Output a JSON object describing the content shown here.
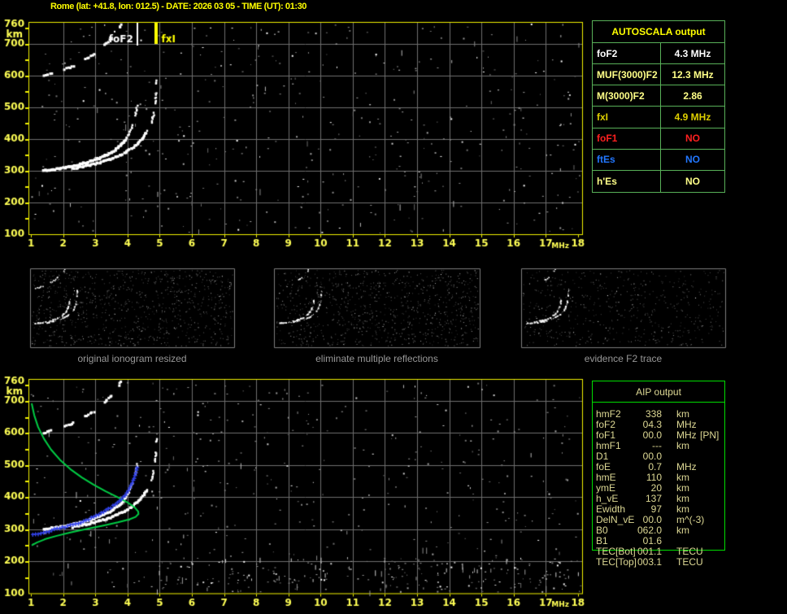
{
  "header": {
    "title": "Rome (lat: +41.8, lon: 012.5) - DATE: 2026 03 05 - TIME (UT): 01:30"
  },
  "colors": {
    "background": "#000000",
    "axis_border": "#f2f200",
    "tick_label": "#ffff55",
    "grid": "#6f6f6f",
    "trace_white": "#ffffff",
    "profile_green": "#00cc44",
    "restored_trace_blue": "#3344ee",
    "fof2_marker": "#ffffff",
    "fxi_marker": "#ffff00",
    "autoscala_border": "#58b058",
    "autoscala_title": "#ffff00",
    "aip_border": "#00dd00",
    "aip_text": "#ddd894",
    "caption_text": "#989898",
    "panel_border": "#7e7e7e"
  },
  "autoscala_table": {
    "title": "AUTOSCALA output",
    "rows": [
      {
        "label": "foF2",
        "value": "4.3 MHz",
        "color": "#ffffff"
      },
      {
        "label": "MUF(3000)F2",
        "value": "12.3 MHz",
        "color": "#ffff88"
      },
      {
        "label": "M(3000)F2",
        "value": "2.86",
        "color": "#ffff88"
      },
      {
        "label": "fxI",
        "value": "4.9 MHz",
        "color": "#dfd000"
      },
      {
        "label": "foF1",
        "value": "NO",
        "color": "#ff2020"
      },
      {
        "label": "ftEs",
        "value": "NO",
        "color": "#2277ff"
      },
      {
        "label": "h'Es",
        "value": "NO",
        "color": "#ffff88"
      }
    ]
  },
  "aip_table": {
    "title": "AIP output",
    "rows": [
      {
        "label": "hmF2",
        "value": "338",
        "unit": "km",
        "extra": ""
      },
      {
        "label": "foF2",
        "value": "04.3",
        "unit": "MHz",
        "extra": ""
      },
      {
        "label": "foF1",
        "value": "00.0",
        "unit": "MHz",
        "extra": "[PN]"
      },
      {
        "label": "hmF1",
        "value": "---",
        "unit": "km",
        "extra": ""
      },
      {
        "label": "D1",
        "value": "00.0",
        "unit": "",
        "extra": ""
      },
      {
        "label": "foE",
        "value": "0.7",
        "unit": "MHz",
        "extra": ""
      },
      {
        "label": "hmE",
        "value": "110",
        "unit": "km",
        "extra": ""
      },
      {
        "label": "ymE",
        "value": "20",
        "unit": "km",
        "extra": ""
      },
      {
        "label": "h_vE",
        "value": "137",
        "unit": "km",
        "extra": ""
      },
      {
        "label": "Ewidth",
        "value": "97",
        "unit": "km",
        "extra": ""
      },
      {
        "label": "DelN_vE",
        "value": "00.0",
        "unit": "m^(-3)",
        "extra": ""
      },
      {
        "label": "B0",
        "value": "062.0",
        "unit": "km",
        "extra": ""
      },
      {
        "label": "B1",
        "value": "01.6",
        "unit": "",
        "extra": ""
      },
      {
        "label": "TEC[Bot]",
        "value": "001.1",
        "unit": "TECU",
        "extra": ""
      },
      {
        "label": "TEC[Top]",
        "value": "003.1",
        "unit": "TECU",
        "extra": ""
      }
    ]
  },
  "panels": [
    {
      "caption": "original ionogram resized"
    },
    {
      "caption": "eliminate multiple reflections"
    },
    {
      "caption": "evidence F2 trace"
    }
  ],
  "chart_data": {
    "type": "scatter",
    "title": "Ionogram: virtual height (km) vs sounding frequency (MHz)",
    "x_axis": {
      "label": "MHz",
      "ticks": [
        1,
        2,
        3,
        4,
        5,
        6,
        7,
        8,
        9,
        10,
        11,
        12,
        13,
        14,
        15,
        16,
        17,
        18
      ],
      "range": [
        0.92,
        18.13
      ]
    },
    "y_axis": {
      "label": "km",
      "ticks": [
        760,
        700,
        600,
        500,
        400,
        300,
        200,
        100
      ],
      "range": [
        100,
        768
      ]
    },
    "grid": true,
    "annotations": [
      {
        "name": "foF2",
        "frequency_mhz": 4.3,
        "color": "#ffffff"
      },
      {
        "name": "fxI",
        "frequency_mhz": 4.9,
        "color": "#ffff00"
      }
    ],
    "traces": {
      "f2_ordinary": [
        [
          1.4,
          300
        ],
        [
          1.6,
          302
        ],
        [
          1.8,
          305
        ],
        [
          2.0,
          308
        ],
        [
          2.2,
          312
        ],
        [
          2.4,
          317
        ],
        [
          2.6,
          322
        ],
        [
          2.8,
          328
        ],
        [
          3.0,
          334
        ],
        [
          3.2,
          342
        ],
        [
          3.4,
          352
        ],
        [
          3.6,
          364
        ],
        [
          3.75,
          376
        ],
        [
          3.9,
          392
        ],
        [
          4.0,
          408
        ],
        [
          4.1,
          428
        ],
        [
          4.18,
          450
        ],
        [
          4.24,
          472
        ],
        [
          4.28,
          492
        ],
        [
          4.3,
          505
        ]
      ],
      "f2_extraordinary": [
        [
          2.3,
          306
        ],
        [
          2.6,
          312
        ],
        [
          2.9,
          319
        ],
        [
          3.2,
          327
        ],
        [
          3.5,
          337
        ],
        [
          3.8,
          350
        ],
        [
          4.05,
          364
        ],
        [
          4.25,
          379
        ],
        [
          4.45,
          398
        ],
        [
          4.6,
          420
        ],
        [
          4.72,
          445
        ],
        [
          4.8,
          472
        ],
        [
          4.85,
          500
        ],
        [
          4.88,
          530
        ],
        [
          4.9,
          560
        ],
        [
          4.91,
          585
        ]
      ],
      "second_hop_reflection": [
        [
          1.4,
          600
        ],
        [
          1.6,
          605
        ],
        [
          1.8,
          610
        ],
        [
          2.0,
          617
        ],
        [
          2.2,
          625
        ],
        [
          2.4,
          634
        ],
        [
          2.6,
          645
        ],
        [
          2.8,
          657
        ],
        [
          3.0,
          670
        ],
        [
          3.2,
          686
        ],
        [
          3.4,
          705
        ],
        [
          3.55,
          722
        ],
        [
          3.7,
          742
        ],
        [
          3.82,
          762
        ]
      ],
      "restored_trace": [
        [
          1.05,
          284
        ],
        [
          1.25,
          288
        ],
        [
          1.45,
          292
        ],
        [
          1.65,
          297
        ],
        [
          1.85,
          302
        ],
        [
          2.05,
          307
        ],
        [
          2.25,
          313
        ],
        [
          2.45,
          319
        ],
        [
          2.65,
          326
        ],
        [
          2.85,
          334
        ],
        [
          3.05,
          343
        ],
        [
          3.25,
          354
        ],
        [
          3.45,
          366
        ],
        [
          3.62,
          378
        ],
        [
          3.78,
          392
        ],
        [
          3.92,
          408
        ],
        [
          4.04,
          426
        ],
        [
          4.14,
          446
        ],
        [
          4.22,
          468
        ],
        [
          4.27,
          487
        ],
        [
          4.3,
          500
        ]
      ],
      "electron_density_profile": [
        [
          1.02,
          692
        ],
        [
          1.1,
          655
        ],
        [
          1.22,
          618
        ],
        [
          1.4,
          582
        ],
        [
          1.62,
          548
        ],
        [
          1.9,
          516
        ],
        [
          2.22,
          487
        ],
        [
          2.58,
          461
        ],
        [
          2.95,
          438
        ],
        [
          3.32,
          418
        ],
        [
          3.68,
          400
        ],
        [
          4.0,
          383
        ],
        [
          4.22,
          368
        ],
        [
          4.33,
          355
        ],
        [
          4.34,
          347
        ],
        [
          4.25,
          338
        ],
        [
          4.05,
          330
        ],
        [
          3.7,
          321
        ],
        [
          3.25,
          311
        ],
        [
          2.75,
          301
        ],
        [
          2.25,
          290
        ],
        [
          1.8,
          279
        ],
        [
          1.45,
          269
        ],
        [
          1.18,
          258
        ],
        [
          1.02,
          249
        ]
      ]
    }
  }
}
